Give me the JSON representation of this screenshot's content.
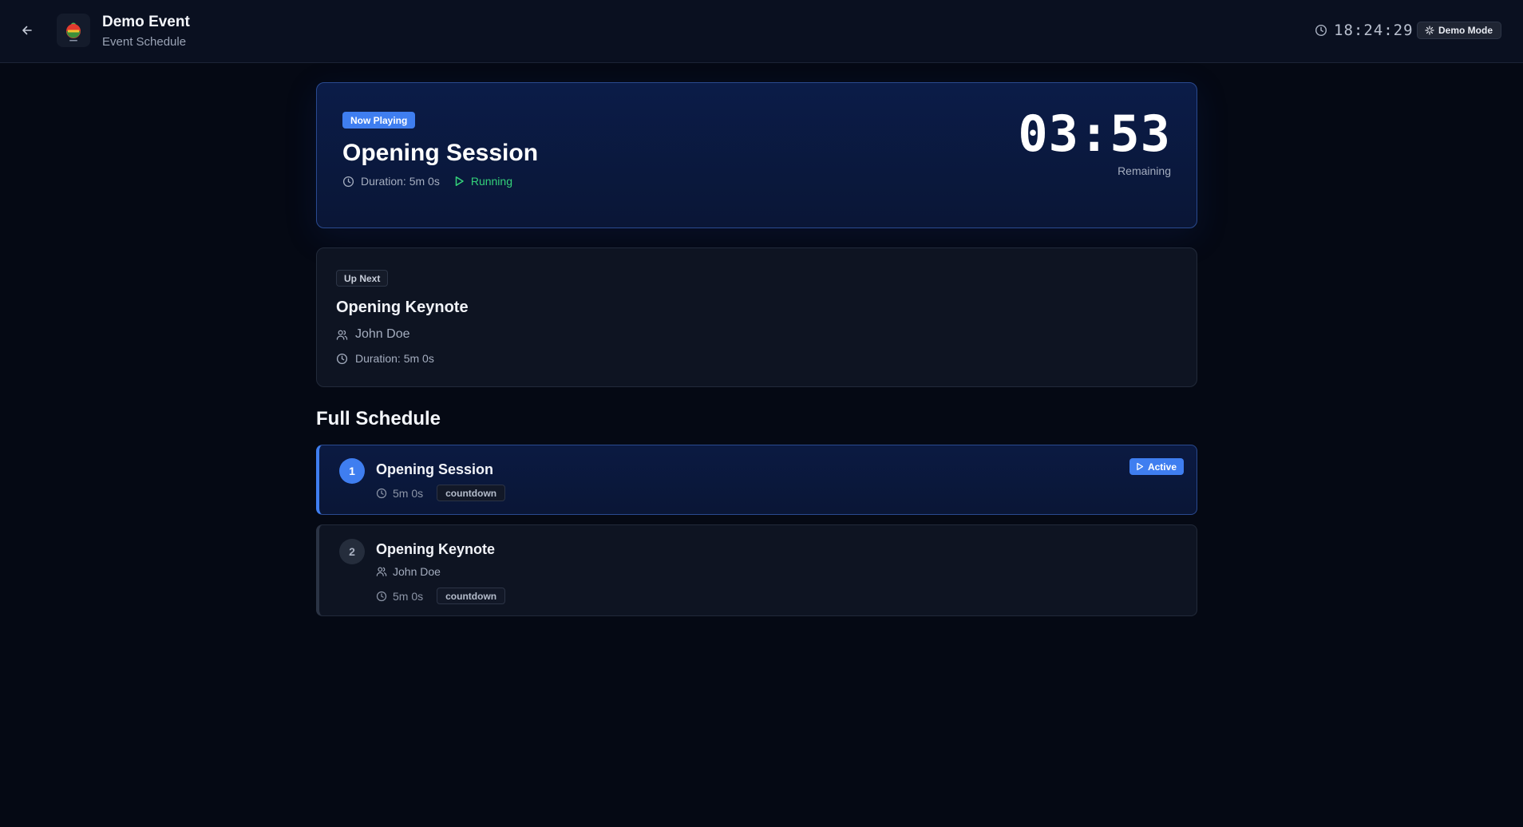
{
  "header": {
    "title": "Demo Event",
    "subtitle": "Event Schedule",
    "clock": "18:24:29",
    "demo_mode_label": "Demo Mode"
  },
  "now_playing": {
    "badge": "Now Playing",
    "title": "Opening Session",
    "duration": "Duration: 5m 0s",
    "status": "Running",
    "countdown": "03:53",
    "countdown_label": "Remaining"
  },
  "up_next": {
    "badge": "Up Next",
    "title": "Opening Keynote",
    "speaker": "John Doe",
    "duration": "Duration: 5m 0s"
  },
  "schedule": {
    "heading": "Full Schedule",
    "items": [
      {
        "number": "1",
        "title": "Opening Session",
        "duration": "5m 0s",
        "type": "countdown",
        "badge": "Active"
      },
      {
        "number": "2",
        "title": "Opening Keynote",
        "speaker": "John Doe",
        "duration": "5m 0s",
        "type": "countdown"
      }
    ]
  },
  "colors": {
    "accent": "#3f7ef0",
    "running": "#34d27a",
    "background": "#050914"
  }
}
